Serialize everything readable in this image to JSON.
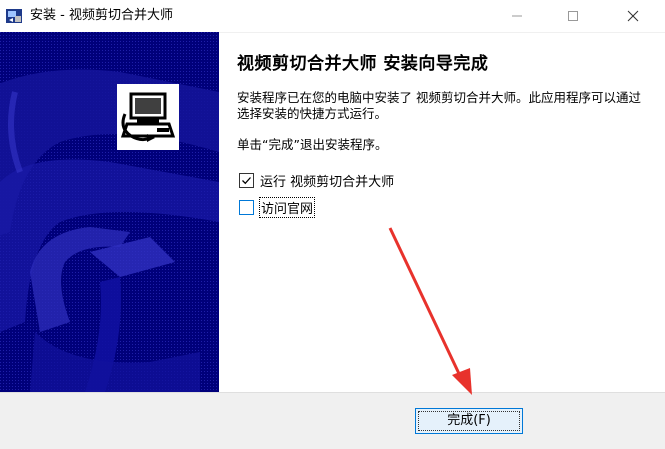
{
  "window": {
    "title": "安装 - 视频剪切合并大师"
  },
  "content": {
    "heading": "视频剪切合并大师  安装向导完成",
    "paragraph": "安装程序已在您的电脑中安装了 视频剪切合并大师。此应用程序可以通过选择安装的快捷方式运行。",
    "paragraph2": "单击“完成”退出安装程序。",
    "checkbox_run": {
      "label": "运行 视频剪切合并大师",
      "checked": true
    },
    "checkbox_site": {
      "label": "访问官网",
      "checked": false
    }
  },
  "footer": {
    "finish_label": "完成(F)"
  },
  "colors": {
    "banner": "#00007a",
    "accent": "#0078d7",
    "annotation": "#e8322c"
  },
  "icons": {
    "app": "installer-icon",
    "logo": "computer-install-icon"
  }
}
